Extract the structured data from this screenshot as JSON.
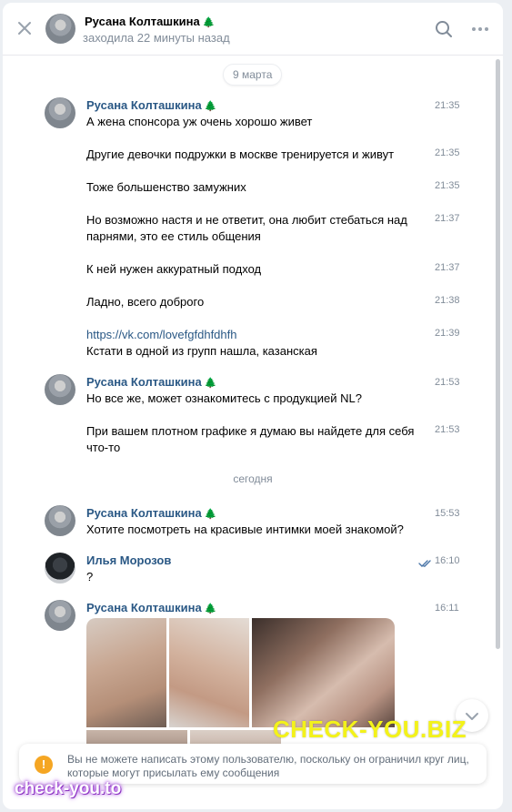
{
  "header": {
    "name": "Русана Колташкина",
    "status": "заходила 22 минуты назад",
    "tree_glyph": "🌲"
  },
  "date_pill": "9 марта",
  "today_label": "сегодня",
  "messages": [
    {
      "author": "Русана Колташкина",
      "text": "А жена спонсора уж очень хорошо живет",
      "time": "21:35"
    },
    {
      "text": "Другие девочки подружки в москве тренируется и живут",
      "time": "21:35"
    },
    {
      "text": "Тоже большенство замужних",
      "time": "21:35"
    },
    {
      "text": "Но возможно настя и не ответит, она любит стебаться над парнями, это ее стиль общения",
      "time": "21:37"
    },
    {
      "text": "К ней нужен аккуратный подход",
      "time": "21:37"
    },
    {
      "text": "Ладно, всего доброго",
      "time": "21:38"
    },
    {
      "link": "https://vk.com/lovefgfdhfdhfh",
      "text": "Кстати в одной из групп нашла, казанская",
      "time": "21:39"
    },
    {
      "author": "Русана Колташкина",
      "text": "Но все же, может ознакомитесь с продукцией NL?",
      "time": "21:53"
    },
    {
      "text": "При вашем плотном графике я думаю вы найдете для себя что-то",
      "time": "21:53"
    },
    {
      "author": "Русана Колташкина",
      "text": "Хотите посмотреть на красивые интимки моей знакомой?",
      "time": "15:53"
    },
    {
      "author": "Илья Морозов",
      "text": "?",
      "time": "16:10"
    },
    {
      "author": "Русана Колташкина",
      "time": "16:11"
    }
  ],
  "notice": "Вы не можете написать этому пользователю, поскольку он ограничил круг лиц, которые могут присылать ему сообщения",
  "notice_icon": "!",
  "watermark_big": "CHECK-YOU.BIZ",
  "watermark_small": "check-you.to",
  "colors": {
    "link": "#2a5885",
    "muted": "#818c99",
    "warning": "#f5a623",
    "check": "#4a76a8"
  }
}
